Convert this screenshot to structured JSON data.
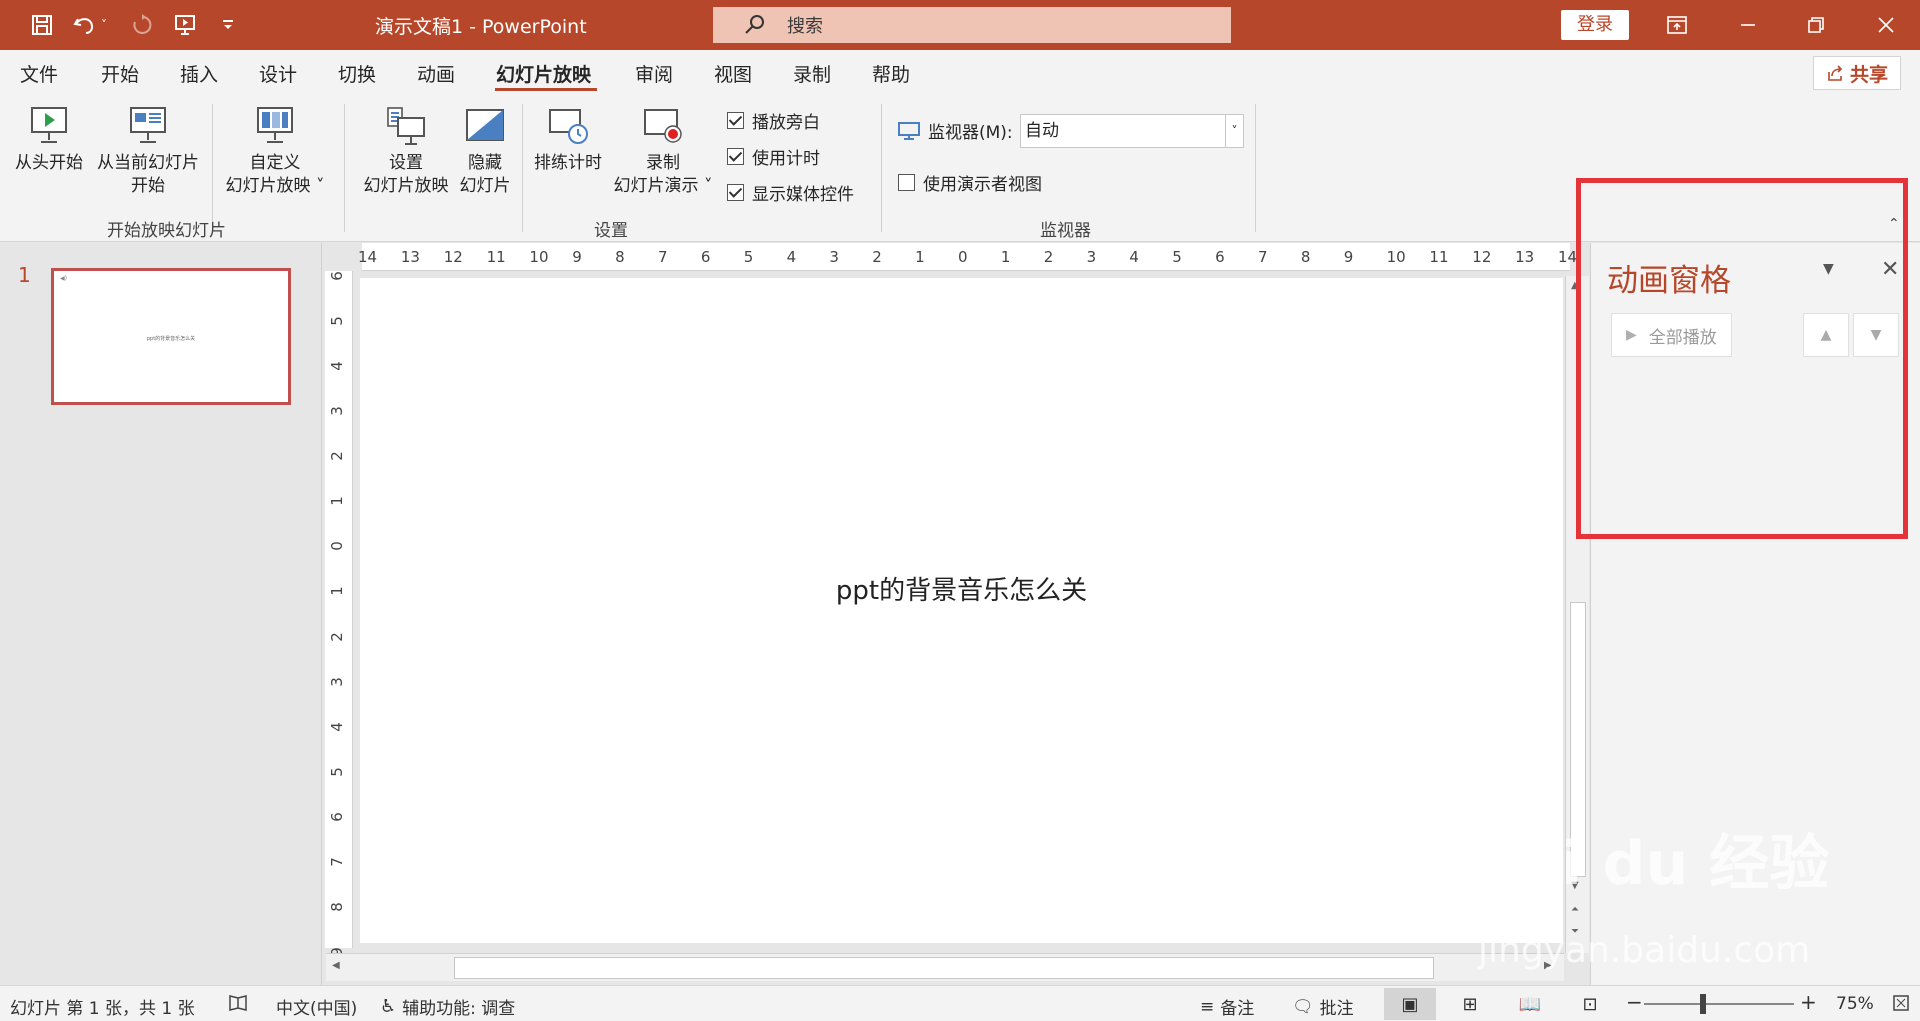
{
  "titlebar": {
    "title": "演示文稿1  -  PowerPoint",
    "search_placeholder": "搜索",
    "login": "登录",
    "quick_access": [
      "save-icon",
      "undo-icon",
      "redo-icon",
      "present-from-start-icon",
      "customize-icon"
    ]
  },
  "menu": {
    "tabs": [
      "文件",
      "开始",
      "插入",
      "设计",
      "切换",
      "动画",
      "幻灯片放映",
      "审阅",
      "视图",
      "录制",
      "帮助"
    ],
    "active_tab": "幻灯片放映",
    "share": "共享"
  },
  "ribbon": {
    "start_group": {
      "label": "开始放映幻灯片",
      "from_beginning": "从头开始",
      "from_current_l1": "从当前幻灯片",
      "from_current_l2": "开始",
      "custom_l1": "自定义",
      "custom_l2": "幻灯片放映 ˅"
    },
    "setup_group": {
      "label": "设置",
      "setup_show_l1": "设置",
      "setup_show_l2": "幻灯片放映",
      "hide_l1": "隐藏",
      "hide_l2": "幻灯片",
      "rehearse": "排练计时",
      "record_l1": "录制",
      "record_l2": "幻灯片演示 ˅",
      "play_narrations": "播放旁白",
      "use_timings": "使用计时",
      "show_media_controls": "显示媒体控件"
    },
    "monitor_group": {
      "label": "监视器",
      "monitor_label": "监视器(M):",
      "monitor_value": "自动",
      "presenter_view": "使用演示者视图"
    }
  },
  "thumbnails": {
    "slide_number": "1",
    "slide_text": "ppt的背景音乐怎么关"
  },
  "rulers": {
    "horizontal": [
      "14",
      "13",
      "12",
      "11",
      "10",
      "9",
      "8",
      "7",
      "6",
      "5",
      "4",
      "3",
      "2",
      "1",
      "0",
      "1",
      "2",
      "3",
      "4",
      "5",
      "6",
      "7",
      "8",
      "9",
      "10",
      "11",
      "12",
      "13",
      "14"
    ],
    "vertical": [
      "6",
      "5",
      "4",
      "3",
      "2",
      "1",
      "0",
      "1",
      "2",
      "3",
      "4",
      "5",
      "6",
      "7",
      "8",
      "9"
    ]
  },
  "slide": {
    "text": "ppt的背景音乐怎么关"
  },
  "animation_pane": {
    "title": "动画窗格",
    "play_all": "全部播放"
  },
  "statusbar": {
    "slide_info": "幻灯片 第 1 张，共 1 张",
    "language": "中文(中国)",
    "accessibility": "辅助功能: 调查",
    "notes": "备注",
    "comments": "批注",
    "zoom": "75%"
  },
  "watermark": {
    "brand": "Bai du 经验",
    "url": "jingyan.baidu.com"
  },
  "colors": {
    "accent": "#b7472a",
    "highlight": "#e5333a"
  }
}
